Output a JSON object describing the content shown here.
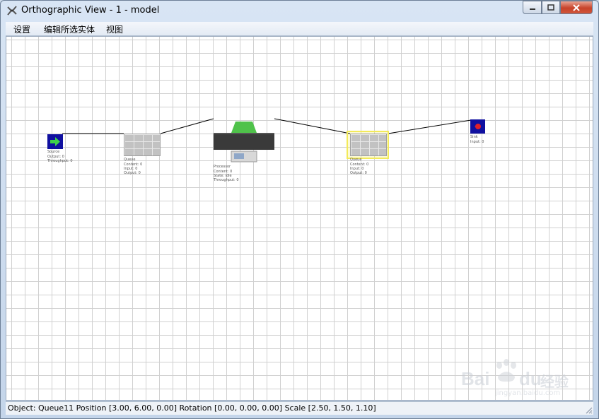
{
  "window": {
    "title": "Orthographic View - 1 - model"
  },
  "menu": {
    "items": [
      "设置",
      "编辑所选实体",
      "视图"
    ]
  },
  "objects": {
    "source": {
      "name": "Source",
      "lines": [
        "Output: 0",
        "Throughput: 0"
      ]
    },
    "queue1": {
      "name": "Queue",
      "lines": [
        "Content: 0",
        "Input: 0",
        "Output: 0"
      ]
    },
    "processor": {
      "name": "Processor",
      "lines": [
        "Content: 0",
        "State: idle",
        "Throughput: 0"
      ]
    },
    "queue2": {
      "name": "Queue",
      "lines": [
        "Content: 0",
        "Input: 0",
        "Output: 0"
      ]
    },
    "sink": {
      "name": "Sink",
      "lines": [
        "Input: 0"
      ]
    }
  },
  "status": {
    "text": "Object: Queue11 Position [3.00, 6.00, 0.00]  Rotation [0.00, 0.00, 0.00]  Scale [2.50, 1.50, 1.10]"
  },
  "watermark": {
    "brand": "Bai",
    "brand2": "du",
    "cn": "经验",
    "url": "jingyan.baidu.com"
  },
  "colors": {
    "source": "#1010a0",
    "sink": "#1010a0",
    "selection": "#f3ea5a",
    "processor_top": "#4fc24a",
    "processor_body": "#3a3a3a"
  }
}
